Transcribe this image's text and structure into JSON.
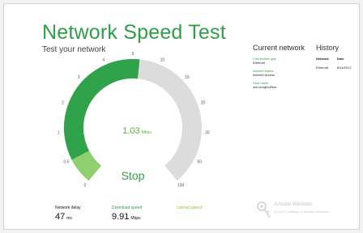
{
  "app": {
    "title": "Network Speed Test",
    "subtitle": "Test your network",
    "accent_color": "#2f9e48"
  },
  "gauge": {
    "scale_max": 100,
    "tick_labels": [
      "0",
      "0.5",
      "1",
      "2",
      "3",
      "4",
      "5",
      "10",
      "15",
      "20",
      "30",
      "50",
      "100"
    ],
    "download_progress_fraction": 0.52,
    "upload_progress_fraction": 0.08,
    "current_speed": "1.03",
    "current_speed_unit": "Mbps",
    "download_color": "#2fa24a",
    "upload_color": "#8fcf6e",
    "track_color": "#dcdcdc"
  },
  "stop_button": {
    "label": "Stop"
  },
  "metrics": {
    "network_delay": {
      "label": "Network delay",
      "value": "47",
      "unit": "ms"
    },
    "download_speed": {
      "label": "Download speed",
      "value": "9.91",
      "unit": "Mbps"
    },
    "upload_speed": {
      "label": "Upload speed"
    }
  },
  "current_network": {
    "heading": "Current network",
    "fields": [
      {
        "label": "Connection type",
        "value": "Ethernet"
      },
      {
        "label": "Internet status",
        "value": "Internet access"
      },
      {
        "label": "Host name",
        "value": "win-ctorghu2few"
      }
    ]
  },
  "history": {
    "heading": "History",
    "columns": [
      "Network",
      "Date"
    ],
    "rows": [
      {
        "network": "Ethernet",
        "date": "8/14/2012"
      }
    ]
  },
  "watermark": {
    "title": "Activate Windows",
    "subtitle": "Go to PC settings to activate Windows"
  }
}
